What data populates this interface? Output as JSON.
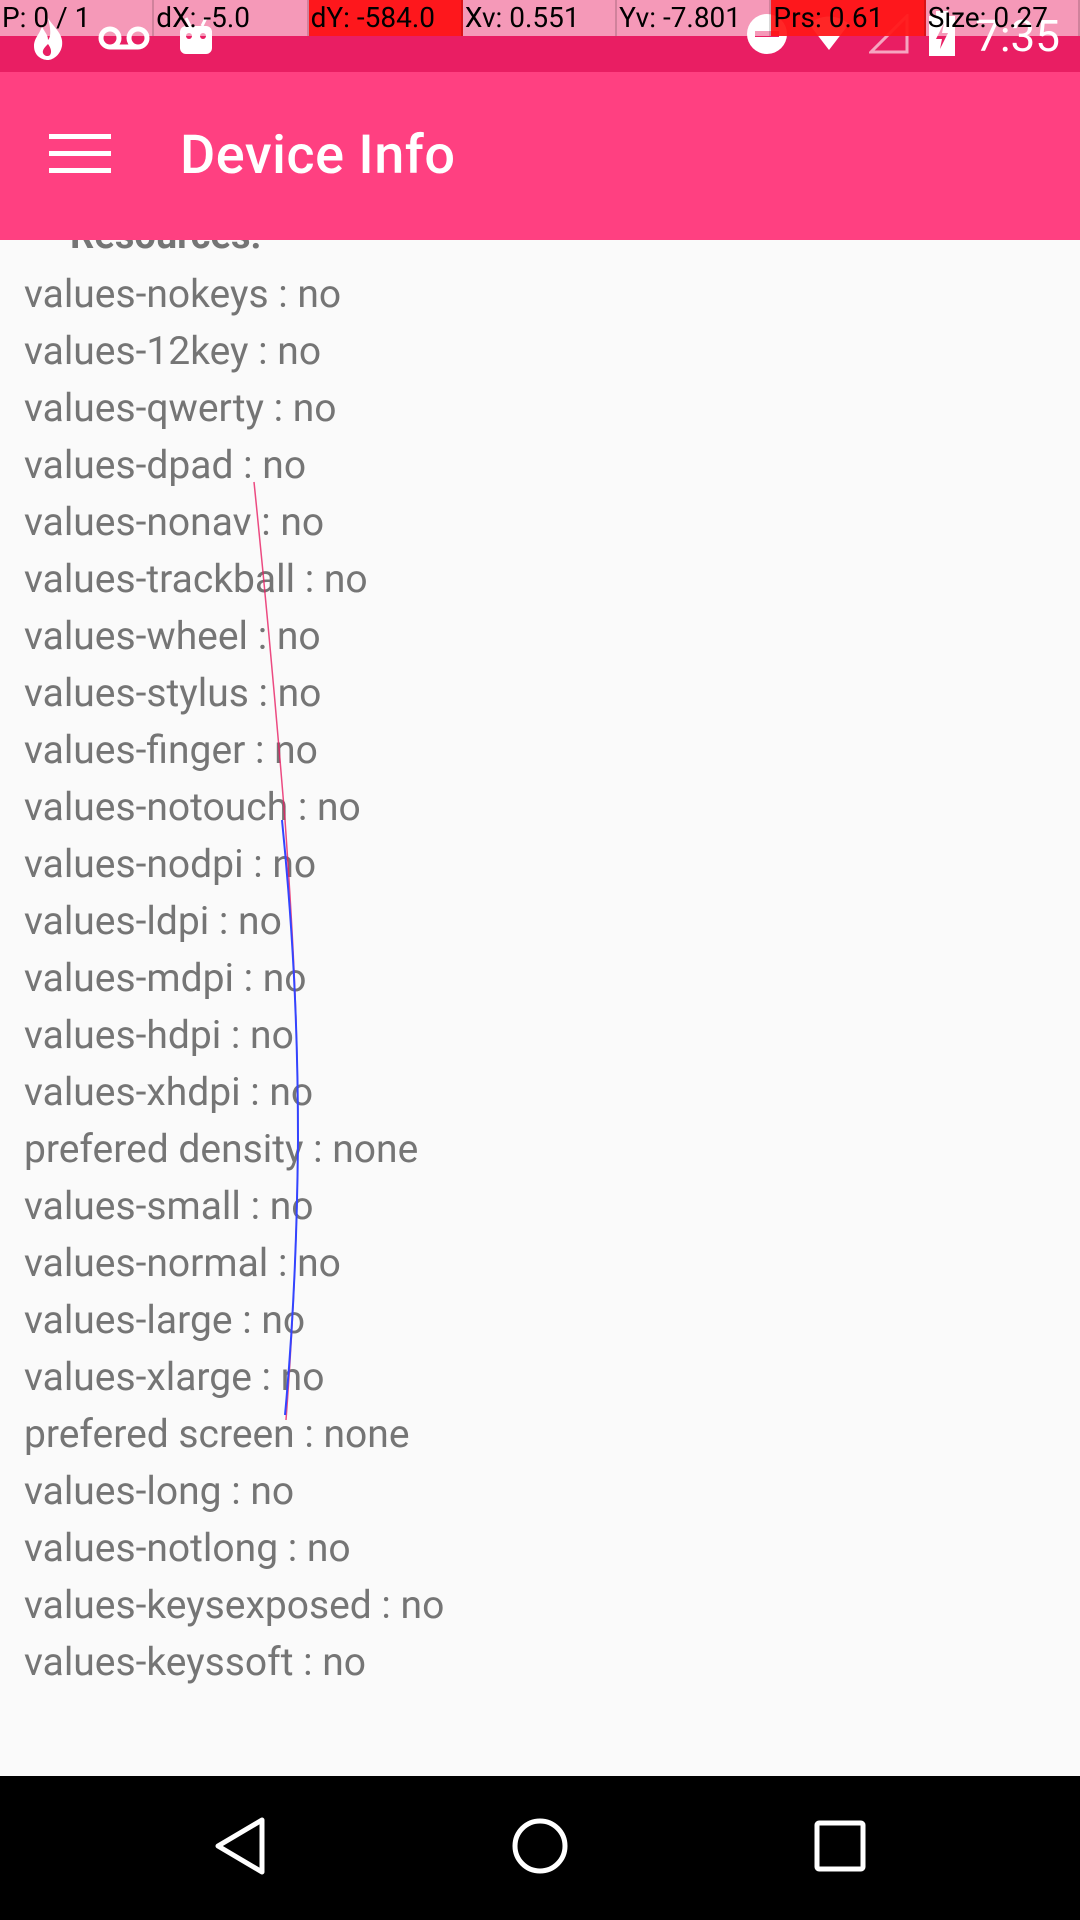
{
  "overlay": {
    "p": "P: 0 / 1",
    "dx": "dX: -5.0",
    "dy": "dY: -584.0",
    "xv": "Xv: 0.551",
    "yv": "Yv: -7.801",
    "prs": "Prs: 0.61",
    "size": "Size: 0.27"
  },
  "status_bar": {
    "time": "7:35",
    "icons_left": [
      "flame-icon",
      "voicemail-icon",
      "android-icon"
    ],
    "icons_right": [
      "do-not-disturb-icon",
      "wifi-icon",
      "signal-icon",
      "battery-icon"
    ]
  },
  "app_bar": {
    "title": "Device Info",
    "menu_icon": "hamburger-menu-icon",
    "background": "#ff4081"
  },
  "content": {
    "partial_header": "Resources:",
    "rows": [
      "values-nokeys : no",
      "values-12key : no",
      "values-qwerty : no",
      "values-dpad : no",
      "values-nonav : no",
      "values-trackball : no",
      "values-wheel : no",
      "values-stylus : no",
      "values-finger : no",
      "values-notouch : no",
      "values-nodpi : no",
      "values-ldpi : no",
      "values-mdpi : no",
      "values-hdpi : no",
      "values-xhdpi : no",
      "prefered density : none",
      "values-small : no",
      "values-normal : no",
      "values-large : no",
      "values-xlarge : no",
      "prefered screen : none",
      "values-long : no",
      "values-notlong : no",
      "values-keysexposed : no",
      "values-keyssoft : no"
    ]
  },
  "nav_bar": {
    "buttons": [
      "back-icon",
      "home-icon",
      "recents-icon"
    ]
  }
}
